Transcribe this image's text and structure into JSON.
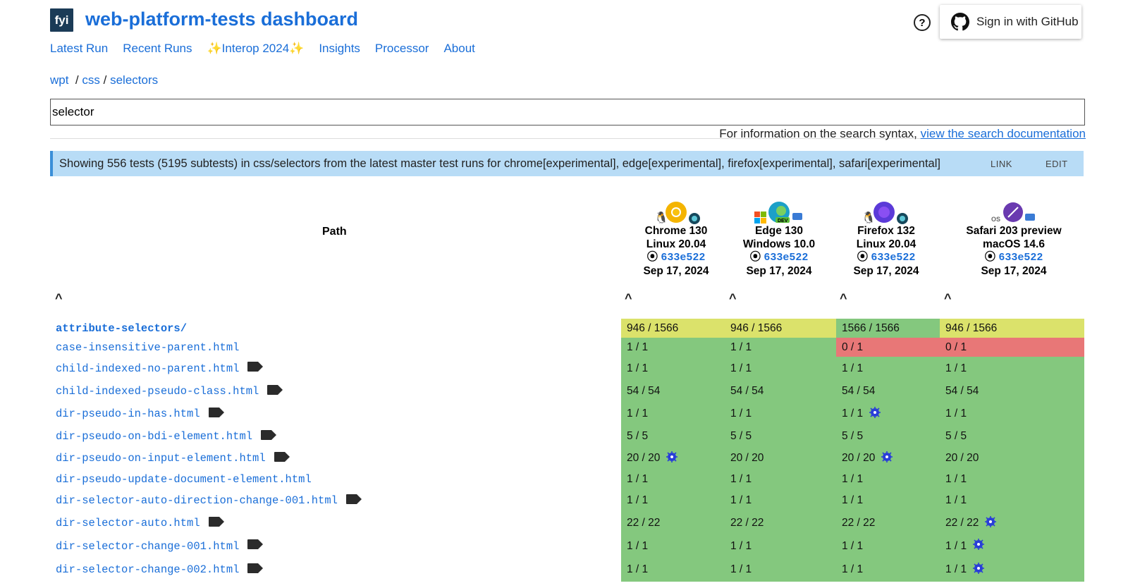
{
  "header": {
    "logo_text": "fyi",
    "title": "web-platform-tests dashboard",
    "help_icon": "help-circle-icon",
    "signin_label": "Sign in with GitHub"
  },
  "nav": [
    "Latest Run",
    "Recent Runs",
    "✨Interop 2024✨",
    "Insights",
    "Processor",
    "About"
  ],
  "breadcrumb": {
    "root": "wpt",
    "sep": "/",
    "items": [
      "css",
      "selectors"
    ]
  },
  "search": {
    "value": "selector",
    "help_text": "For information on the search syntax,",
    "help_link": "view the search documentation"
  },
  "banner": {
    "text": "Showing 556 tests (5195 subtests) in css/selectors from the latest master test runs for chrome[experimental], edge[experimental], firefox[experimental], safari[experimental]",
    "link_label": "LINK",
    "edit_label": "EDIT"
  },
  "table": {
    "path_header": "Path",
    "sort_glyph": "^",
    "runs": [
      {
        "browser": "Chrome 130",
        "os": "Linux 20.04",
        "rev": "633e522",
        "date": "Sep 17, 2024"
      },
      {
        "browser": "Edge 130",
        "os": "Windows 10.0",
        "rev": "633e522",
        "date": "Sep 17, 2024"
      },
      {
        "browser": "Firefox 132",
        "os": "Linux 20.04",
        "rev": "633e522",
        "date": "Sep 17, 2024"
      },
      {
        "browser": "Safari 203 preview",
        "os": "macOS 14.6",
        "rev": "633e522",
        "date": "Sep 17, 2024"
      }
    ],
    "rows": [
      {
        "path": "attribute-selectors/",
        "dir": true,
        "tag": false,
        "cells": [
          "946 / 1566",
          "946 / 1566",
          "1566 / 1566",
          "946 / 1566"
        ],
        "bugs": [
          false,
          false,
          false,
          false
        ]
      },
      {
        "path": "case-insensitive-parent.html",
        "dir": false,
        "tag": false,
        "cells": [
          "1 / 1",
          "1 / 1",
          "0 / 1",
          "0 / 1"
        ],
        "bugs": [
          false,
          false,
          false,
          false
        ]
      },
      {
        "path": "child-indexed-no-parent.html",
        "dir": false,
        "tag": true,
        "cells": [
          "1 / 1",
          "1 / 1",
          "1 / 1",
          "1 / 1"
        ],
        "bugs": [
          false,
          false,
          false,
          false
        ]
      },
      {
        "path": "child-indexed-pseudo-class.html",
        "dir": false,
        "tag": true,
        "cells": [
          "54 / 54",
          "54 / 54",
          "54 / 54",
          "54 / 54"
        ],
        "bugs": [
          false,
          false,
          false,
          false
        ]
      },
      {
        "path": "dir-pseudo-in-has.html",
        "dir": false,
        "tag": true,
        "cells": [
          "1 / 1",
          "1 / 1",
          "1 / 1",
          "1 / 1"
        ],
        "bugs": [
          false,
          false,
          true,
          false
        ]
      },
      {
        "path": "dir-pseudo-on-bdi-element.html",
        "dir": false,
        "tag": true,
        "cells": [
          "5 / 5",
          "5 / 5",
          "5 / 5",
          "5 / 5"
        ],
        "bugs": [
          false,
          false,
          false,
          false
        ]
      },
      {
        "path": "dir-pseudo-on-input-element.html",
        "dir": false,
        "tag": true,
        "cells": [
          "20 / 20",
          "20 / 20",
          "20 / 20",
          "20 / 20"
        ],
        "bugs": [
          true,
          false,
          true,
          false
        ]
      },
      {
        "path": "dir-pseudo-update-document-element.html",
        "dir": false,
        "tag": false,
        "cells": [
          "1 / 1",
          "1 / 1",
          "1 / 1",
          "1 / 1"
        ],
        "bugs": [
          false,
          false,
          false,
          false
        ]
      },
      {
        "path": "dir-selector-auto-direction-change-001.html",
        "dir": false,
        "tag": true,
        "cells": [
          "1 / 1",
          "1 / 1",
          "1 / 1",
          "1 / 1"
        ],
        "bugs": [
          false,
          false,
          false,
          false
        ]
      },
      {
        "path": "dir-selector-auto.html",
        "dir": false,
        "tag": true,
        "cells": [
          "22 / 22",
          "22 / 22",
          "22 / 22",
          "22 / 22"
        ],
        "bugs": [
          false,
          false,
          false,
          true
        ]
      },
      {
        "path": "dir-selector-change-001.html",
        "dir": false,
        "tag": true,
        "cells": [
          "1 / 1",
          "1 / 1",
          "1 / 1",
          "1 / 1"
        ],
        "bugs": [
          false,
          false,
          false,
          true
        ]
      },
      {
        "path": "dir-selector-change-002.html",
        "dir": false,
        "tag": true,
        "cells": [
          "1 / 1",
          "1 / 1",
          "1 / 1",
          "1 / 1"
        ],
        "bugs": [
          false,
          false,
          false,
          true
        ]
      }
    ],
    "colors": {
      "pass": "#84c87e",
      "partial": "#dbe26b",
      "fail": "#e87777"
    }
  }
}
